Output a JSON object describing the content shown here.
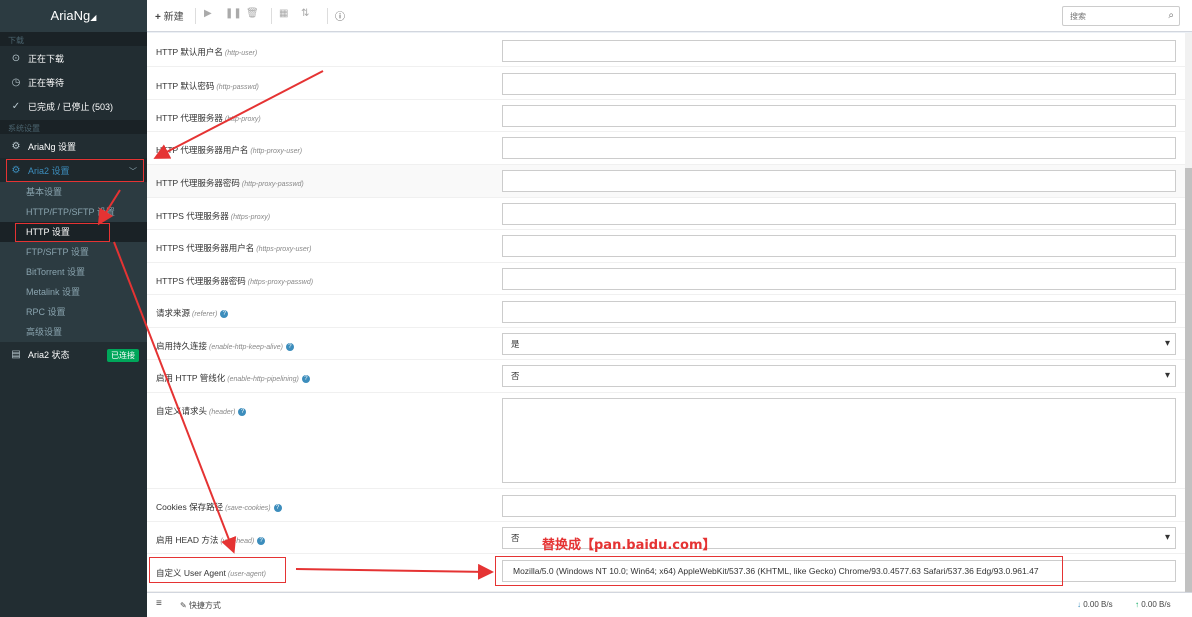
{
  "app": {
    "title": "AriaNg"
  },
  "sidebar": {
    "section_download": "下载",
    "downloading": "正在下载",
    "waiting": "正在等待",
    "stopped": "已完成 / 已停止 (503)",
    "section_settings": "系统设置",
    "ariang_settings": "AriaNg 设置",
    "aria2_settings": "Aria2 设置",
    "sub_items": [
      "基本设置",
      "HTTP/FTP/SFTP 设置",
      "HTTP 设置",
      "FTP/SFTP 设置",
      "BitTorrent 设置",
      "Metalink 设置",
      "RPC 设置",
      "高级设置"
    ],
    "aria2_status": "Aria2 状态",
    "status_badge": "已连接"
  },
  "toolbar": {
    "new_label": "新建",
    "search_placeholder": "搜索"
  },
  "settings": [
    {
      "label": "HTTP 默认用户名",
      "key": "(http-user)",
      "value": ""
    },
    {
      "label": "HTTP 默认密码",
      "key": "(http-passwd)",
      "value": ""
    },
    {
      "label": "HTTP 代理服务器",
      "key": "(http-proxy)",
      "value": ""
    },
    {
      "label": "HTTP 代理服务器用户名",
      "key": "(http-proxy-user)",
      "value": ""
    },
    {
      "label": "HTTP 代理服务器密码",
      "key": "(http-proxy-passwd)",
      "value": ""
    },
    {
      "label": "HTTPS 代理服务器",
      "key": "(https-proxy)",
      "value": ""
    },
    {
      "label": "HTTPS 代理服务器用户名",
      "key": "(https-proxy-user)",
      "value": ""
    },
    {
      "label": "HTTPS 代理服务器密码",
      "key": "(https-proxy-passwd)",
      "value": ""
    },
    {
      "label": "请求来源",
      "key": "(referer)",
      "value": ""
    },
    {
      "label": "启用持久连接",
      "key": "(enable-http-keep-alive)",
      "value": "是"
    },
    {
      "label": "启用 HTTP 管线化",
      "key": "(enable-http-pipelining)",
      "value": "否"
    },
    {
      "label": "自定义请求头",
      "key": "(header)",
      "value": ""
    },
    {
      "label": "Cookies 保存路径",
      "key": "(save-cookies)",
      "value": ""
    },
    {
      "label": "启用 HEAD 方法",
      "key": "(use-head)",
      "value": "否"
    },
    {
      "label": "自定义 User Agent",
      "key": "(user-agent)",
      "value": "Mozilla/5.0 (Windows NT 10.0; Win64; x64) AppleWebKit/537.36 (KHTML, like Gecko) Chrome/93.0.4577.63 Safari/537.36 Edg/93.0.961.47"
    }
  ],
  "annotation": {
    "text": "替换成【pan.baidu.com】"
  },
  "footer": {
    "shortcut": "快捷方式",
    "download_speed": "0.00 B/s",
    "upload_speed": "0.00 B/s"
  },
  "colors": {
    "sidebar_bg": "#222d32",
    "accent": "#3c8dbc",
    "badge": "#00a65a",
    "annotation_red": "#e53333"
  }
}
